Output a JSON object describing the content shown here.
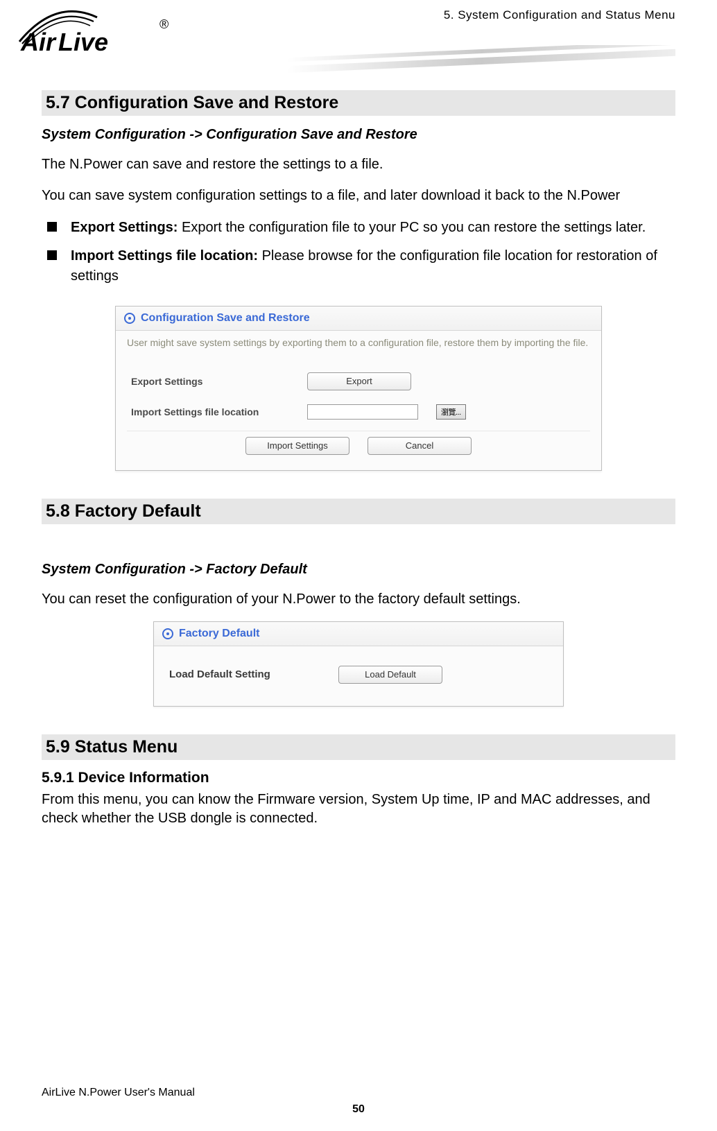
{
  "header": {
    "chapter": "5.  System  Configuration  and  Status  Menu",
    "logo_text": "Air Live"
  },
  "sections": {
    "s57": {
      "title": "5.7 Configuration  Save  and  Restore",
      "breadcrumb": "System Configuration -> Configuration Save and Restore",
      "p1": "The N.Power can save and restore the settings to a file.",
      "p2": "You can save system configuration settings to a file, and later download it back to the N.Power",
      "bullets": [
        {
          "label": "Export Settings:",
          "text": "   Export the configuration file to your PC so you can restore the settings later."
        },
        {
          "label": "Import Settings file location:",
          "text": "  Please browse for the configuration file location for restoration of settings"
        }
      ],
      "panel": {
        "title": "Configuration Save and Restore",
        "hint": "User might save system settings by exporting them to a configuration file, restore them by importing the file.",
        "export_label": "Export Settings",
        "export_btn": "Export",
        "import_label": "Import Settings file location",
        "browse_btn": "瀏覽...",
        "import_btn": "Import Settings",
        "cancel_btn": "Cancel"
      }
    },
    "s58": {
      "title": "5.8 Factory  Default",
      "breadcrumb": "System Configuration -> Factory Default",
      "p1": "You can reset the configuration of your N.Power to the factory default settings.",
      "panel": {
        "title": "Factory Default",
        "label": "Load Default Setting",
        "btn": "Load Default"
      }
    },
    "s59": {
      "title": "5.9 Status  Menu",
      "sub_title": "5.9.1 Device Information",
      "p1": "From this menu, you can know the Firmware version, System Up time, IP and MAC addresses, and check whether the USB dongle is connected."
    }
  },
  "footer": {
    "manual": "AirLive N.Power User's Manual",
    "page_number": "50"
  }
}
